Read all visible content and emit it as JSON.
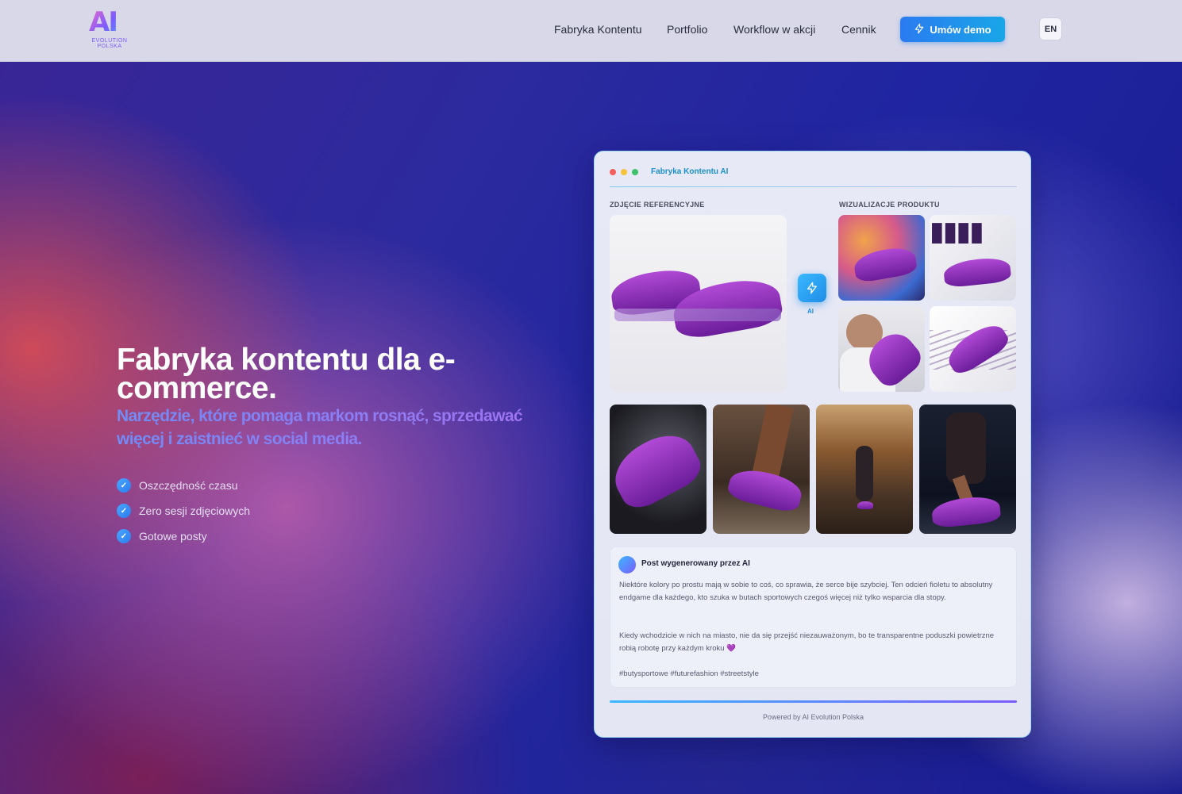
{
  "header": {
    "logo_text": "AI",
    "logo_sub": "EVOLUTION POLSKA",
    "nav": [
      "Fabryka Kontentu",
      "Portfolio",
      "Workflow w akcji",
      "Cennik"
    ],
    "cta_label": "Umów demo",
    "lang_label": "EN"
  },
  "hero": {
    "title": "Fabryka kontentu dla e-commerce.",
    "subtitle": "Narzędzie, które pomaga markom rosnąć, sprzedawać więcej i zaistnieć w social media.",
    "benefits": [
      "Oszczędność czasu",
      "Zero sesji zdjęciowych",
      "Gotowe posty"
    ]
  },
  "app_card": {
    "title": "Fabryka Kontentu AI",
    "reference_label": "ZDJĘCIE REFERENCYJNE",
    "visuals_label": "WIZUALIZACJE PRODUKTU",
    "ai_label": "AI",
    "post": {
      "heading": "Post wygenerowany przez AI",
      "paragraph_1": "Niektóre kolory po prostu mają w sobie to coś, co sprawia, że serce bije szybciej. Ten odcień fioletu to absolutny endgame dla każdego, kto szuka w butach sportowych czegoś więcej niż tylko wsparcia dla stopy.",
      "paragraph_2": "Kiedy wchodzicie w nich na miasto, nie da się przejść niezauważonym, bo te transparentne poduszki powietrzne robią robotę przy każdym kroku 💜",
      "hashtags": "#butysportowe #futurefashion #streetstyle"
    },
    "footer": "Powered by AI Evolution Polska"
  },
  "colors": {
    "accent": "#2b7bf0",
    "brand_purple": "#7b5cff",
    "shoe_purple": "#9b34c8"
  }
}
